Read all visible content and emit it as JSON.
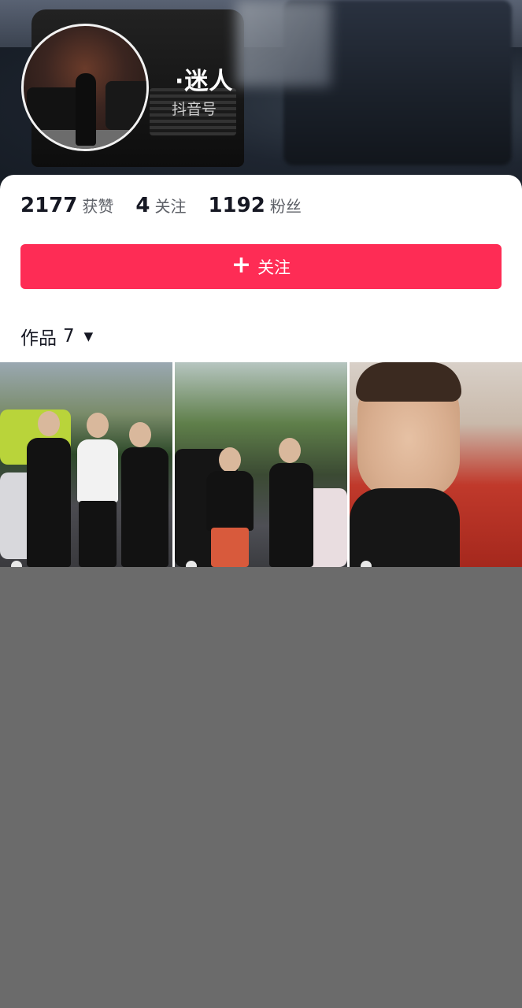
{
  "profile": {
    "nickname": "·迷人",
    "douyin_id_label": "抖音号"
  },
  "stats": {
    "likes": {
      "value": "2177",
      "label": "获赞"
    },
    "following": {
      "value": "4",
      "label": "关注"
    },
    "followers": {
      "value": "1192",
      "label": "粉丝"
    }
  },
  "follow_button": {
    "icon": "plus-icon",
    "label": "关注",
    "color": "#fe2c55"
  },
  "works_tab": {
    "label": "作品",
    "count": "7",
    "icon": "caret-down-icon"
  },
  "videos": [
    {
      "thumb": "three men in black and white standing in front of cars"
    },
    {
      "thumb": "two men in front of SUV and colorful car"
    },
    {
      "thumb": "young man selfie in front of red ribbons"
    }
  ]
}
